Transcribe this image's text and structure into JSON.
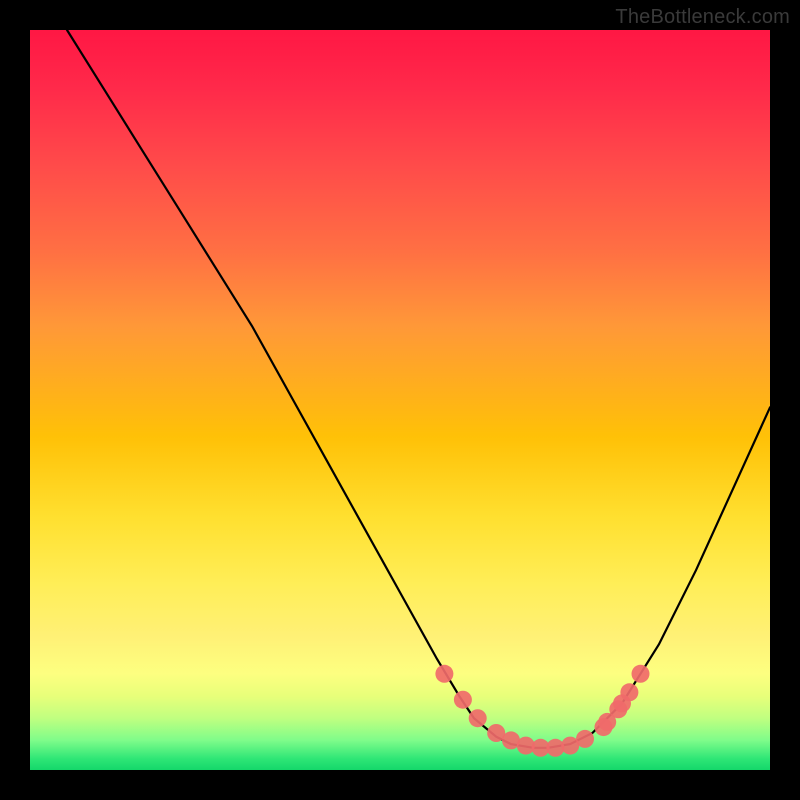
{
  "watermark": "TheBottleneck.com",
  "chart_data": {
    "type": "line",
    "title": "",
    "xlabel": "",
    "ylabel": "",
    "xlim": [
      0,
      100
    ],
    "ylim": [
      0,
      100
    ],
    "grid": false,
    "legend": false,
    "series": [
      {
        "name": "curve",
        "x": [
          5,
          10,
          15,
          20,
          25,
          30,
          35,
          40,
          45,
          50,
          55,
          58,
          60,
          63,
          65,
          68,
          70,
          73,
          76,
          80,
          85,
          90,
          95,
          100
        ],
        "y": [
          100,
          92,
          84,
          76,
          68,
          60,
          51,
          42,
          33,
          24,
          15,
          10,
          7,
          4.5,
          3.5,
          3,
          3,
          3.5,
          5,
          9,
          17,
          27,
          38,
          49
        ]
      }
    ],
    "markers": {
      "name": "highlight-points",
      "x": [
        56,
        58.5,
        60.5,
        63,
        65,
        67,
        69,
        71,
        73,
        75,
        77.5,
        79.5,
        81,
        82.5,
        80,
        78
      ],
      "y": [
        13,
        9.5,
        7,
        5,
        4,
        3.3,
        3,
        3,
        3.3,
        4.2,
        5.8,
        8.2,
        10.5,
        13,
        9,
        6.5
      ]
    },
    "gradient_colors": {
      "top": "#ff1744",
      "mid": "#ffe030",
      "bottom": "#14d76a"
    }
  }
}
